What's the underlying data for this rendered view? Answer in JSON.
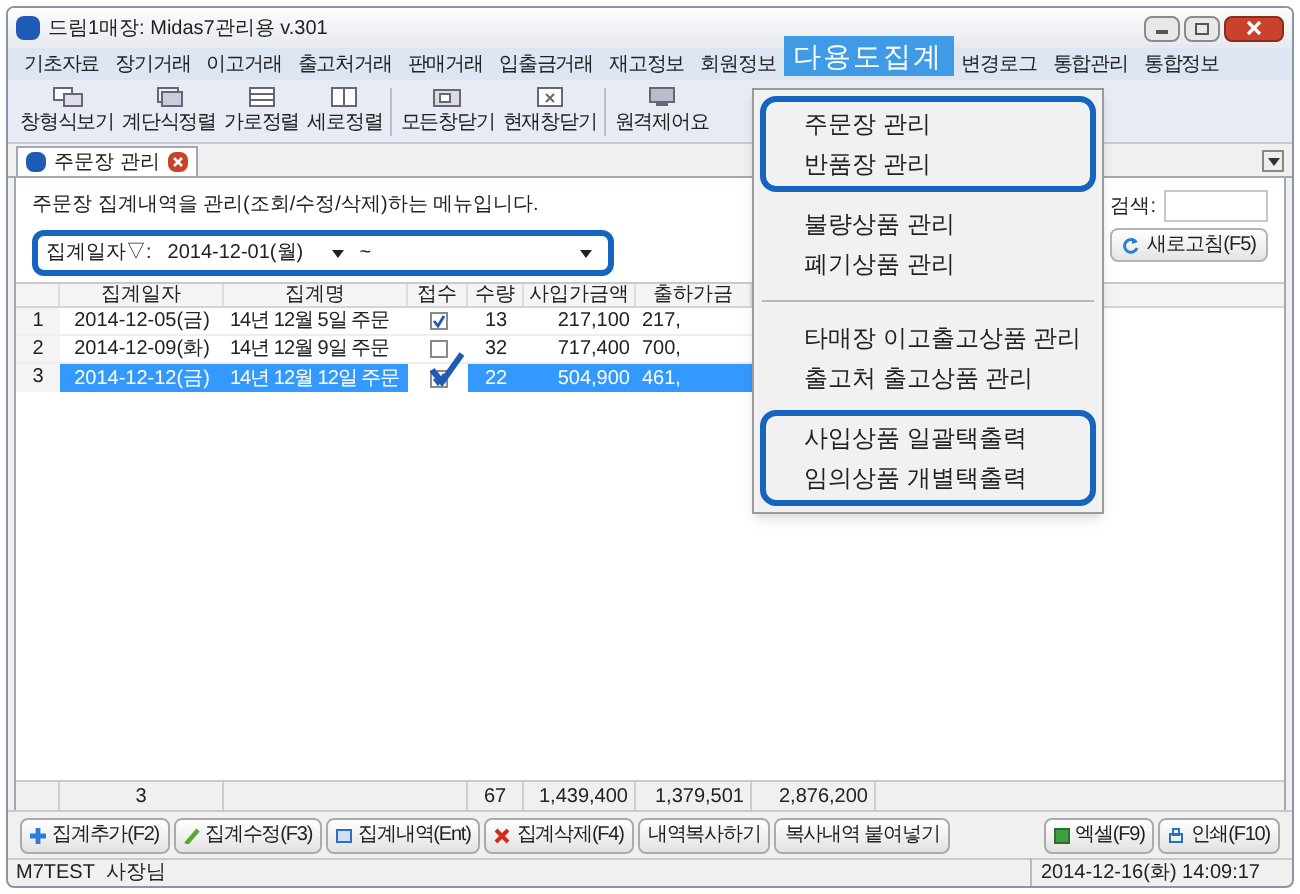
{
  "window": {
    "title": "드림1매장: Midas7관리용 v.301"
  },
  "menu_bar": [
    {
      "label": "기초자료",
      "selected": false
    },
    {
      "label": "장기거래",
      "selected": false
    },
    {
      "label": "이고거래",
      "selected": false
    },
    {
      "label": "출고처거래",
      "selected": false
    },
    {
      "label": "판매거래",
      "selected": false
    },
    {
      "label": "입출금거래",
      "selected": false
    },
    {
      "label": "재고정보",
      "selected": false
    },
    {
      "label": "회원정보",
      "selected": false
    },
    {
      "label": "다용도집계",
      "selected": true
    },
    {
      "label": "변경로그",
      "selected": false
    },
    {
      "label": "통합관리",
      "selected": false
    },
    {
      "label": "통합정보",
      "selected": false
    }
  ],
  "toolbar": [
    {
      "label": "창형식보기",
      "kind": "cascade"
    },
    {
      "label": "계단식정렬",
      "kind": "stack"
    },
    {
      "label": "가로정렬",
      "kind": "rows"
    },
    {
      "label": "세로정렬",
      "kind": "cols"
    },
    {
      "label": "모든창닫기",
      "kind": "closeall"
    },
    {
      "label": "현재창닫기",
      "kind": "close"
    },
    {
      "label": "원격제어요",
      "kind": "remote"
    }
  ],
  "tabs": [
    {
      "label": "주문장 관리",
      "selected": true
    }
  ],
  "description": "주문장 집계내역을 관리(조회/수정/삭제)하는 메뉴입니다.",
  "filter": {
    "label": "집계일자▽:",
    "from": "2014-12-01(월)",
    "separator": "~"
  },
  "search": {
    "label": "검색:"
  },
  "refresh_button": "새로고침(F5)",
  "grid": {
    "columns": [
      "집계일자",
      "집계명",
      "접수",
      "수량",
      "사입가금액",
      "출하가금"
    ],
    "rows": [
      {
        "number": "1",
        "date": "2014-12-05(금)",
        "name": "14년 12월 5일 주문",
        "received": true,
        "qty": "13",
        "cost": "217,100",
        "price": "217,",
        "selected": false
      },
      {
        "number": "2",
        "date": "2014-12-09(화)",
        "name": "14년 12월 9일 주문",
        "received": false,
        "qty": "32",
        "cost": "717,400",
        "price": "700,",
        "selected": false
      },
      {
        "number": "3",
        "date": "2014-12-12(금)",
        "name": "14년 12월 12일 주문",
        "received": true,
        "qty": "22",
        "cost": "504,900",
        "price": "461,",
        "selected": true
      }
    ],
    "totals": {
      "count": "3",
      "qty": "67",
      "cost": "1,439,400",
      "price": "1,379,501",
      "column_8": "2,876,200"
    }
  },
  "buttons": [
    {
      "label": "집계추가(F2)",
      "kind": "add"
    },
    {
      "label": "집계수정(F3)",
      "kind": "edit"
    },
    {
      "label": "집계내역(Ent)",
      "kind": "detail"
    },
    {
      "label": "집계삭제(F4)",
      "kind": "delete"
    },
    {
      "label": "내역복사하기",
      "kind": "plain"
    },
    {
      "label": "복사내역 붙여넣기",
      "kind": "plain"
    }
  ],
  "right_buttons": [
    {
      "label": "엑셀(F9)",
      "kind": "excel"
    },
    {
      "label": "인쇄(F10)",
      "kind": "print"
    }
  ],
  "status": {
    "user": "M7TEST  사장님",
    "datetime": "2014-12-16(화) 14:09:17"
  },
  "dropdown": {
    "groups": [
      {
        "highlighted": true,
        "items": [
          "주문장 관리",
          "반품장 관리"
        ]
      },
      {
        "highlighted": false,
        "items": [
          "불량상품 관리",
          "폐기상품 관리"
        ]
      },
      {
        "highlighted": false,
        "items": [
          "타매장 이고출고상품 관리",
          "출고처 출고상품 관리"
        ]
      },
      {
        "highlighted": true,
        "items": [
          "사입상품 일괄택출력",
          "임의상품 개별택출력"
        ]
      }
    ]
  }
}
